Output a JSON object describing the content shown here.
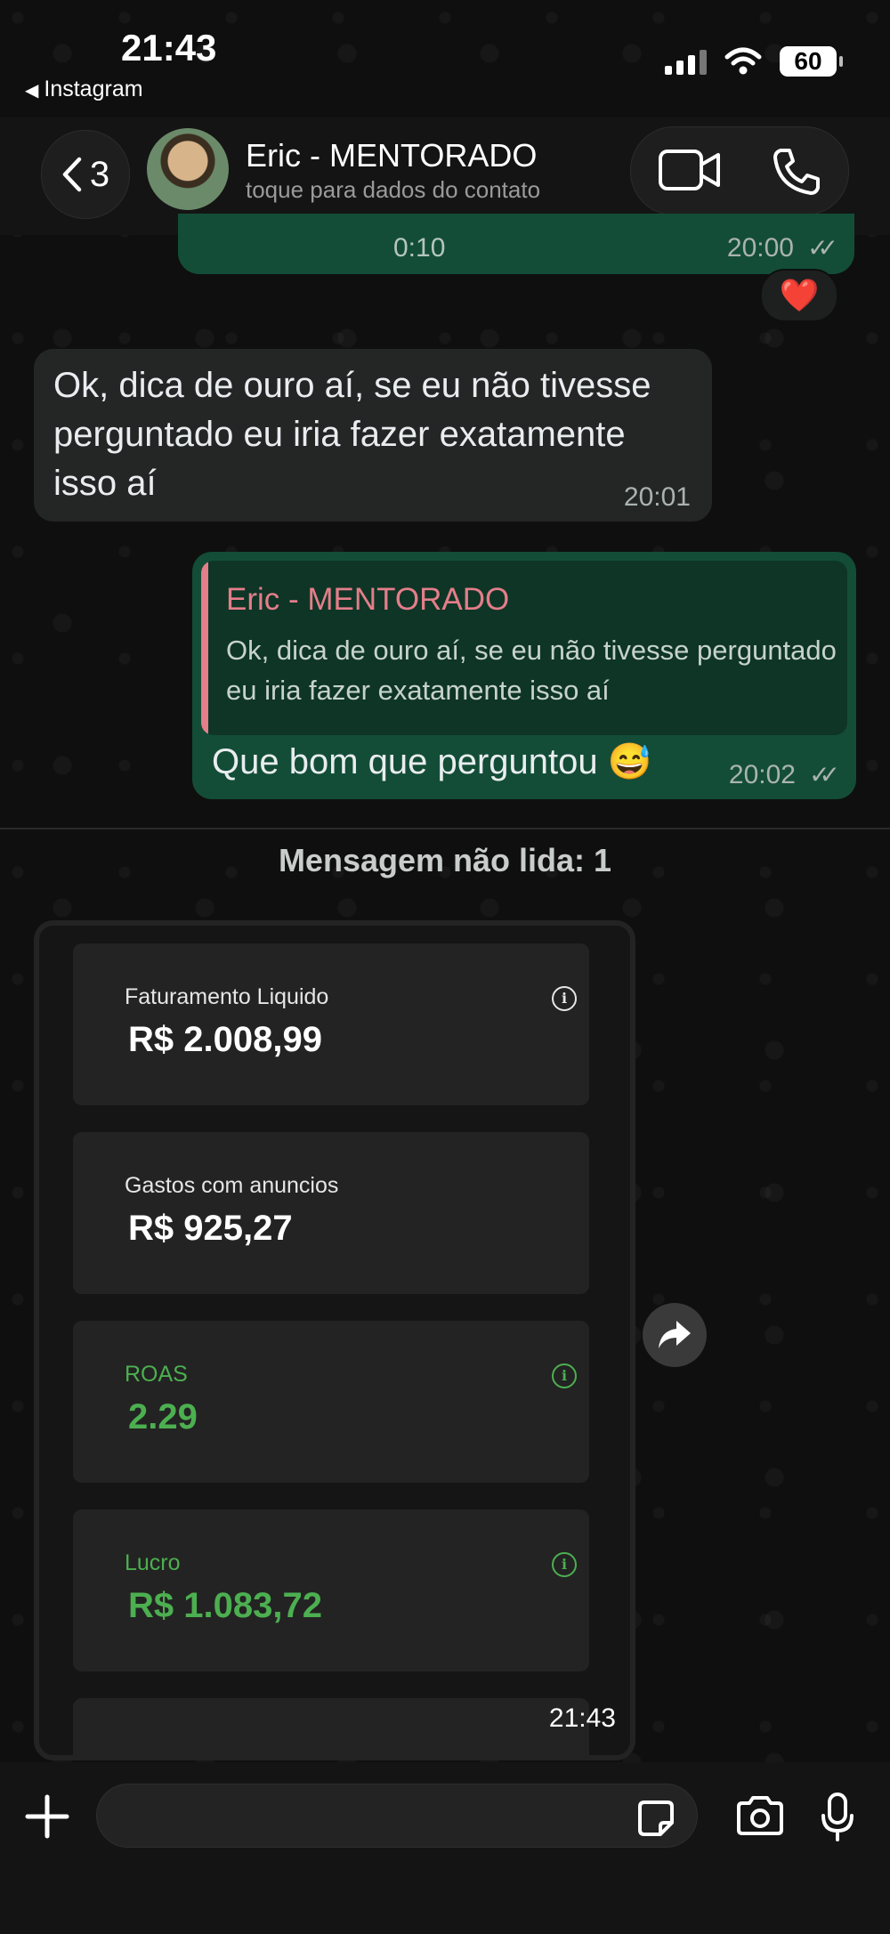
{
  "status": {
    "time": "21:43",
    "back_app": "Instagram",
    "battery": "60"
  },
  "header": {
    "back_count": "3",
    "contact_name": "Eric - MENTORADO",
    "contact_subtitle": "toque para dados do contato"
  },
  "messages": {
    "audio": {
      "duration": "0:10",
      "time": "20:00",
      "status": "read"
    },
    "reaction": "❤️",
    "incoming_1": {
      "text": "Ok, dica de ouro aí, se eu não tivesse perguntado eu iria fazer exatamente isso aí",
      "time": "20:01"
    },
    "outgoing_reply": {
      "quoted_name": "Eric - MENTORADO",
      "quoted_text": "Ok, dica de ouro aí, se eu não tivesse perguntado eu iria fazer exatamente isso aí",
      "text": "Que bom que perguntou 😅",
      "time": "20:02",
      "status": "read"
    }
  },
  "unread_label": "Mensagem não lida: 1",
  "image_message": {
    "time": "21:43",
    "cards": [
      {
        "label": "Faturamento Liquido",
        "value": "R$ 2.008,99",
        "color": "#ffffff"
      },
      {
        "label": "Gastos com anuncios",
        "value": "R$ 925,27",
        "color": "#ffffff"
      },
      {
        "label": "ROAS",
        "value": "2.29",
        "color": "#4caf50"
      },
      {
        "label": "Lucro",
        "value": "R$ 1.083,72",
        "color": "#4caf50"
      }
    ]
  },
  "composer": {
    "value": ""
  },
  "colors": {
    "outgoing_bubble": "#134d37",
    "incoming_bubble": "#242626",
    "quote_accent": "#e47e8a",
    "positive": "#4caf50"
  }
}
